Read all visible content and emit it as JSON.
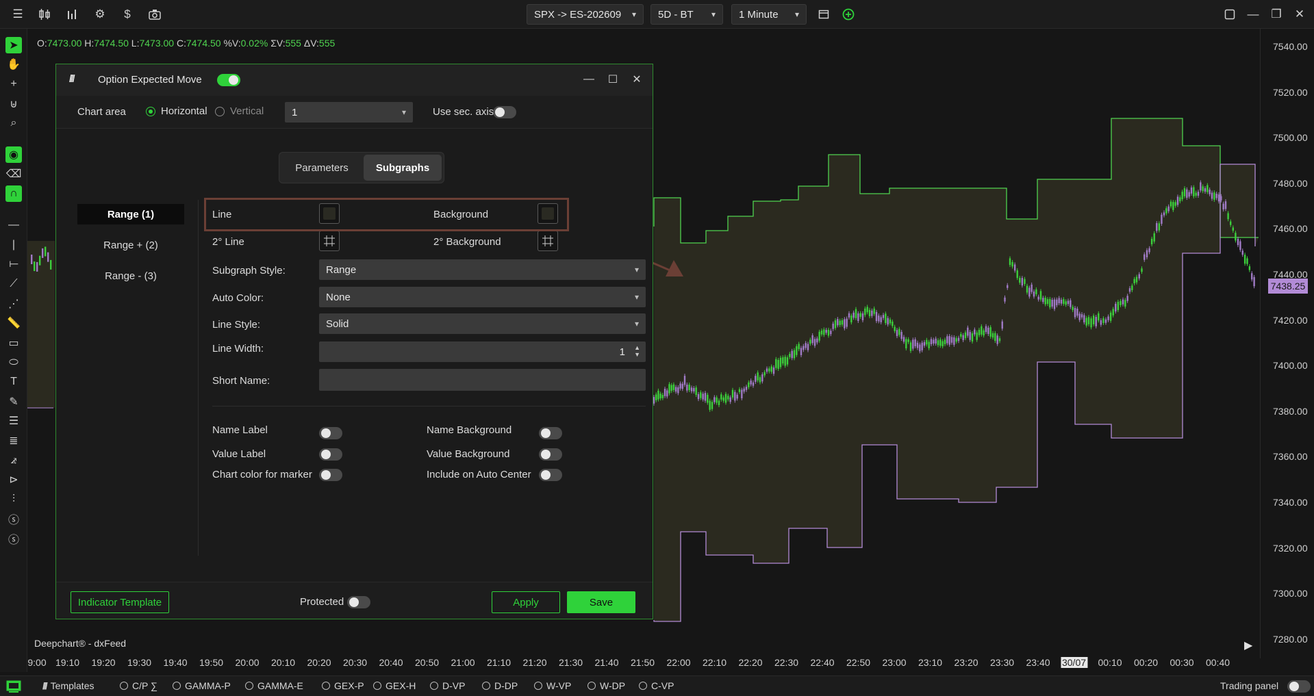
{
  "topbar": {
    "symbol": "SPX -> ES-202609",
    "period": "5D - BT",
    "interval": "1 Minute"
  },
  "ohlc": {
    "o_label": "O:",
    "o": "7473.00",
    "h_label": "H:",
    "h": "7474.50",
    "l_label": "L:",
    "l": "7473.00",
    "c_label": "C:",
    "c": "7474.50",
    "pv_label": "%V:",
    "pv": "0.02%",
    "sv_label": "ΣV:",
    "sv": "555",
    "dv_label": "ΔV:",
    "dv": "555"
  },
  "y_axis": [
    "7540.00",
    "7520.00",
    "7500.00",
    "7480.00",
    "7460.00",
    "7440.00",
    "7420.00",
    "7400.00",
    "7380.00",
    "7360.00",
    "7340.00",
    "7320.00",
    "7300.00",
    "7280.00"
  ],
  "last_price": "7438.25",
  "x_axis": [
    "9:00",
    "19:10",
    "19:20",
    "19:30",
    "19:40",
    "19:50",
    "20:00",
    "20:10",
    "20:20",
    "20:30",
    "20:40",
    "20:50",
    "21:00",
    "21:10",
    "21:20",
    "21:30",
    "21:40",
    "21:50",
    "22:00",
    "22:10",
    "22:20",
    "22:30",
    "22:40",
    "22:50",
    "23:00",
    "23:10",
    "23:20",
    "23:30",
    "23:40",
    "30/07",
    "00:10",
    "00:20",
    "00:30",
    "00:40"
  ],
  "chart_title": "Deepchart® - dxFeed",
  "colors": {
    "accent": "#2fd23a",
    "upper_line": "#4fd34f",
    "lower_line": "#b28bd6",
    "band_fill": "#2b2a1f",
    "highlight_box": "#6b3f35"
  },
  "dialog": {
    "title": "Option Expected Move",
    "chart_area_label": "Chart area",
    "horizontal_label": "Horizontal",
    "vertical_label": "Vertical",
    "area_select": "1",
    "sec_axis_label": "Use sec. axis",
    "tabs": {
      "parameters": "Parameters",
      "subgraphs": "Subgraphs"
    },
    "subgraphs": [
      "Range (1)",
      "Range + (2)",
      "Range - (3)"
    ],
    "fields": {
      "line": "Line",
      "background": "Background",
      "line2": "2° Line",
      "background2": "2° Background",
      "style_label": "Subgraph Style:",
      "style_value": "Range",
      "auto_color_label": "Auto Color:",
      "auto_color_value": "None",
      "line_style_label": "Line Style:",
      "line_style_value": "Solid",
      "line_width_label": "Line Width:",
      "line_width_value": "1",
      "short_name_label": "Short Name:",
      "short_name_value": ""
    },
    "toggles": {
      "name_label": "Name Label",
      "name_background": "Name Background",
      "value_label": "Value Label",
      "value_background": "Value Background",
      "chart_color_marker": "Chart color for marker",
      "include_auto_center": "Include on Auto Center"
    },
    "footer": {
      "template": "Indicator Template",
      "protected": "Protected",
      "apply": "Apply",
      "save": "Save"
    }
  },
  "bottombar": {
    "templates": "Templates",
    "indicators": [
      "C/P ∑",
      "GAMMA-P",
      "GAMMA-E",
      "GEX-P",
      "GEX-H",
      "D-VP",
      "D-DP",
      "W-VP",
      "W-DP",
      "C-VP"
    ],
    "trading_panel": "Trading panel"
  }
}
